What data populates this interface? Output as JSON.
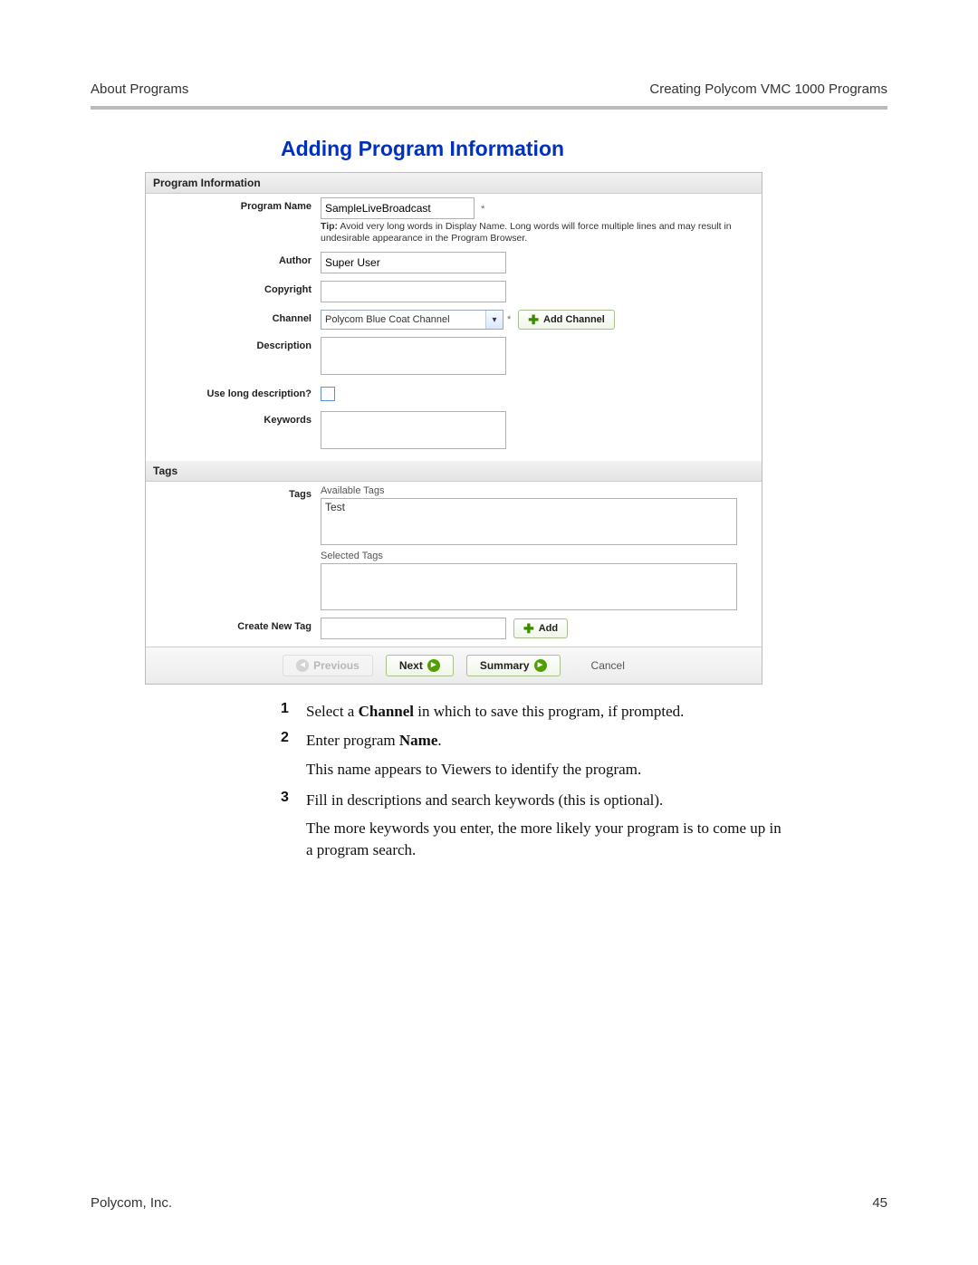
{
  "header": {
    "left": "About Programs",
    "right": "Creating Polycom VMC 1000 Programs"
  },
  "title": "Adding Program Information",
  "panels": {
    "program_info": "Program Information",
    "tags": "Tags"
  },
  "labels": {
    "program_name": "Program Name",
    "author": "Author",
    "copyright": "Copyright",
    "channel": "Channel",
    "description": "Description",
    "use_long_desc": "Use long description?",
    "keywords": "Keywords",
    "tags": "Tags",
    "create_new_tag": "Create New Tag"
  },
  "fields": {
    "program_name": "SampleLiveBroadcast",
    "author": "Super User",
    "copyright": "",
    "channel_selected": "Polycom Blue Coat Channel",
    "description": "",
    "keywords": "",
    "available_tags_label": "Available Tags",
    "available_tags_item": "Test",
    "selected_tags_label": "Selected Tags",
    "new_tag": ""
  },
  "tip": {
    "prefix": "Tip:",
    "text": " Avoid very long words in Display Name. Long words will force multiple lines and may result in undesirable appearance in the Program Browser."
  },
  "buttons": {
    "add_channel": "Add Channel",
    "add": "Add",
    "previous": "Previous",
    "next": "Next",
    "summary": "Summary",
    "cancel": "Cancel"
  },
  "instructions": {
    "i1_pre": "Select a ",
    "i1_bold": "Channel",
    "i1_post": " in which to save this program, if prompted.",
    "i2_pre": "Enter program ",
    "i2_bold": "Name",
    "i2_post": ".",
    "i2_sub": "This name appears to Viewers to identify the program.",
    "i3": "Fill in descriptions and search keywords (this is optional).",
    "i3_sub": "The more keywords you enter, the more likely your program is to come up in a program search."
  },
  "footer": {
    "left": "Polycom, Inc.",
    "right": "45"
  }
}
